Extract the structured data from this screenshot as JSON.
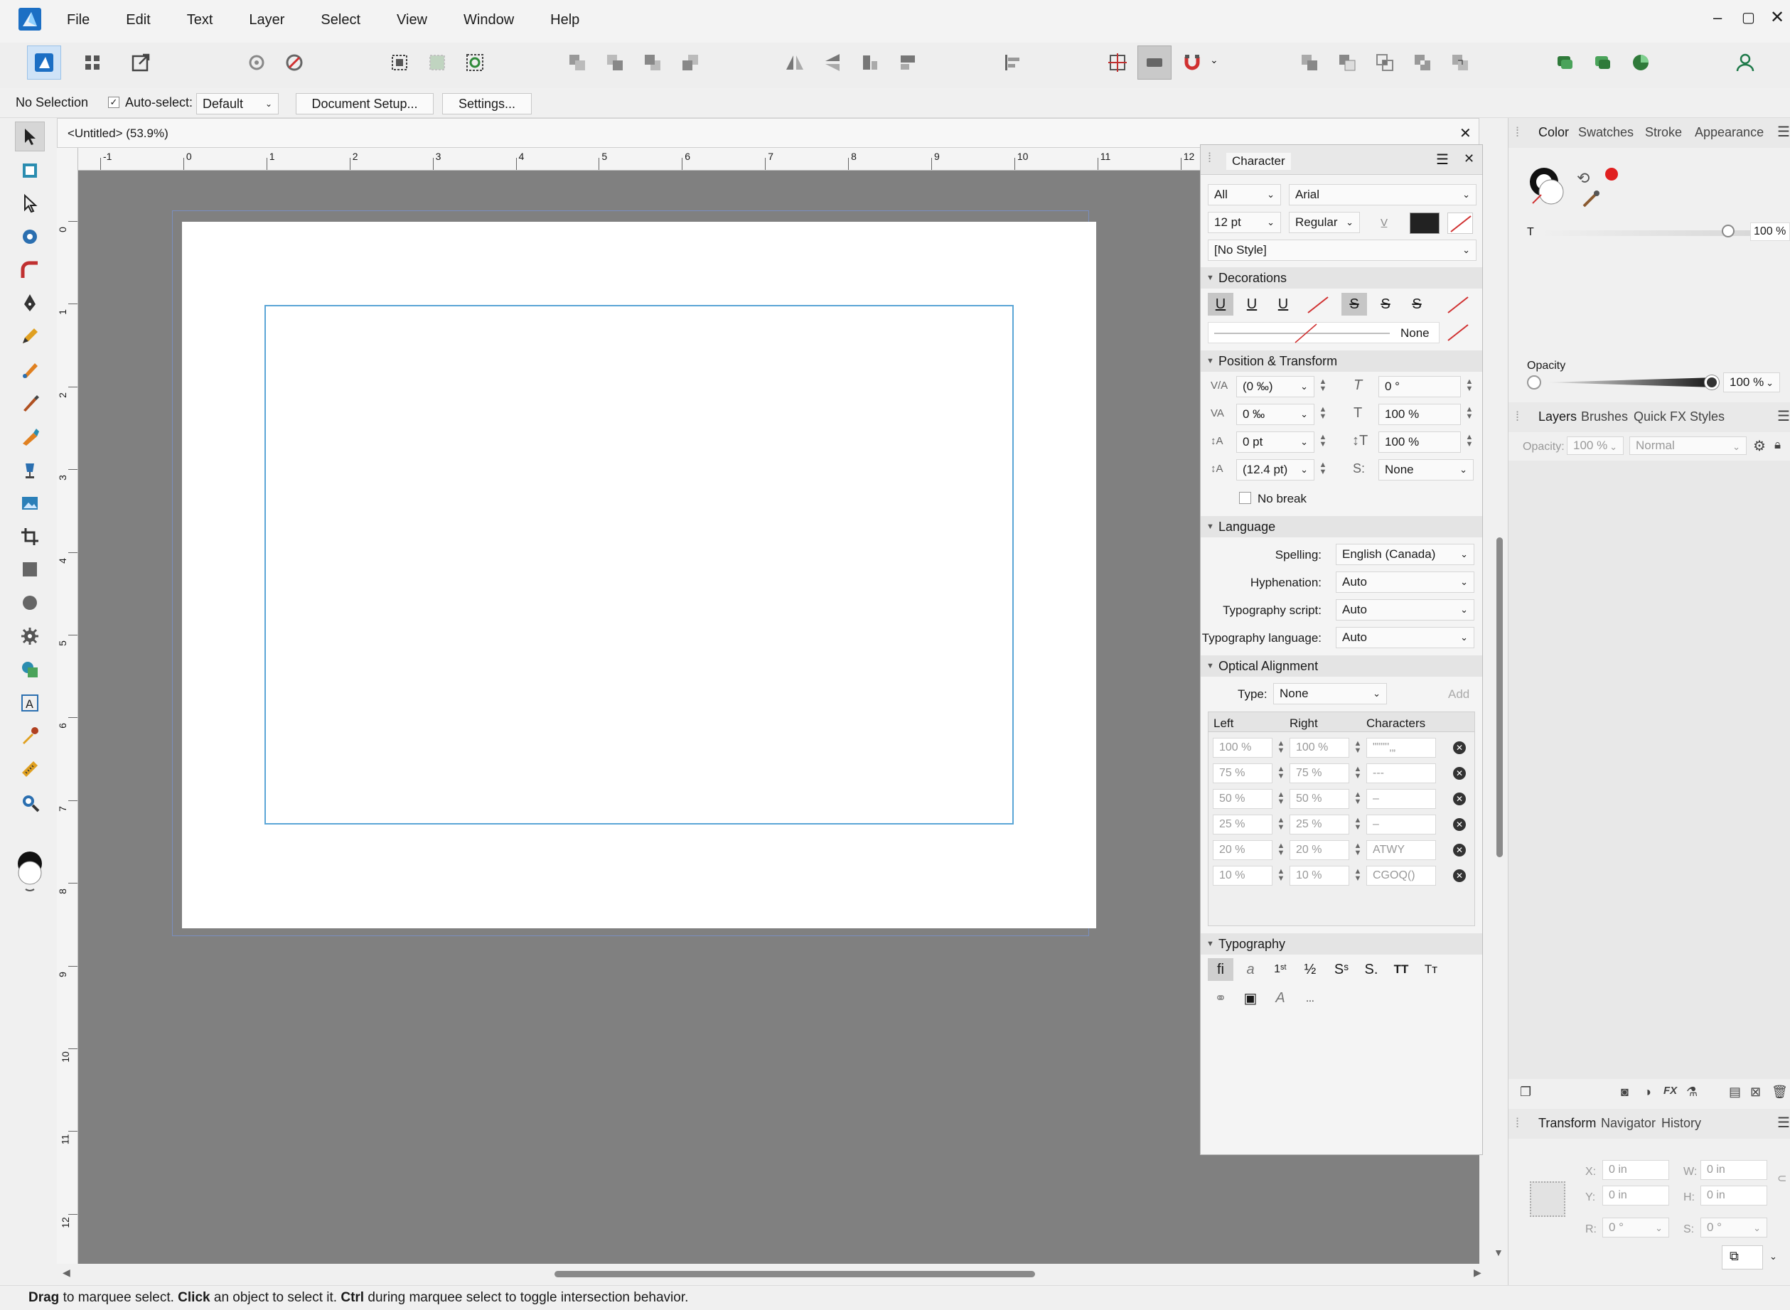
{
  "menubar": {
    "items": [
      "File",
      "Edit",
      "Text",
      "Layer",
      "Select",
      "View",
      "Window",
      "Help"
    ]
  },
  "context": {
    "selection": "No Selection",
    "autoselect_label": "Auto-select:",
    "autoselect_value": "Default",
    "doc_setup": "Document Setup...",
    "settings": "Settings..."
  },
  "document": {
    "tab_title": "<Untitled> (53.9%)",
    "ruler_unit": "in",
    "h_ticks": [
      "-1",
      "0",
      "1",
      "2",
      "3",
      "4",
      "5",
      "6",
      "7",
      "8",
      "9",
      "10",
      "11",
      "12"
    ],
    "v_ticks": [
      "0",
      "1",
      "2",
      "3",
      "4",
      "5",
      "6",
      "7",
      "8",
      "9",
      "10",
      "11",
      "12"
    ]
  },
  "character": {
    "title": "Character",
    "scope": "All",
    "font": "Arial",
    "size": "12 pt",
    "weight": "Regular",
    "style": "[No Style]",
    "decorations_label": "Decorations",
    "decoration_line": "None",
    "pos_label": "Position & Transform",
    "tracking": "(0 ‰)",
    "kerning": "0 ‰",
    "baseline": "0 pt",
    "leading": "(12.4 pt)",
    "shear": "0 °",
    "hscale": "100 %",
    "vscale": "100 %",
    "sub": "None",
    "nobreak": "No break",
    "language_label": "Language",
    "spelling_label": "Spelling:",
    "spelling": "English (Canada)",
    "hyph_label": "Hyphenation:",
    "hyph": "Auto",
    "script_label": "Typography script:",
    "script": "Auto",
    "lang_label": "Typography language:",
    "lang": "Auto",
    "optical_label": "Optical Alignment",
    "type_label": "Type:",
    "type": "None",
    "add": "Add",
    "col_left": "Left",
    "col_right": "Right",
    "col_chars": "Characters",
    "rows": [
      {
        "l": "100 %",
        "r": "100 %",
        "c": "\"\"\"''‚„"
      },
      {
        "l": "75 %",
        "r": "75 %",
        "c": "---"
      },
      {
        "l": "50 %",
        "r": "50 %",
        "c": "–"
      },
      {
        "l": "25 %",
        "r": "25 %",
        "c": "–"
      },
      {
        "l": "20 %",
        "r": "20 %",
        "c": "ATWY"
      },
      {
        "l": "10 %",
        "r": "10 %",
        "c": "CGOQ()"
      }
    ],
    "typography_label": "Typography"
  },
  "color_panel": {
    "tabs": [
      "Color",
      "Swatches",
      "Stroke",
      "Appearance"
    ],
    "t_label": "T",
    "t_value": "100 %",
    "opacity_label": "Opacity",
    "opacity_value": "100 %",
    "colors": {
      "swatch_red": "#e02020"
    }
  },
  "layers_panel": {
    "tabs": [
      "Layers",
      "Brushes",
      "Quick FX",
      "Styles"
    ],
    "opacity_label": "Opacity:",
    "opacity": "100 %",
    "blend": "Normal"
  },
  "transform_panel": {
    "tabs": [
      "Transform",
      "Navigator",
      "History"
    ],
    "x_label": "X:",
    "x": "0 in",
    "y_label": "Y:",
    "y": "0 in",
    "w_label": "W:",
    "w": "0 in",
    "h_label": "H:",
    "h": "0 in",
    "r_label": "R:",
    "r": "0 °",
    "s_label": "S:",
    "s": "0 °"
  },
  "status": {
    "drag": "Drag",
    "t1": " to marquee select. ",
    "click": "Click",
    "t2": " an object to select it. ",
    "ctrl": "Ctrl",
    "t3": " during marquee select to toggle intersection behavior."
  }
}
